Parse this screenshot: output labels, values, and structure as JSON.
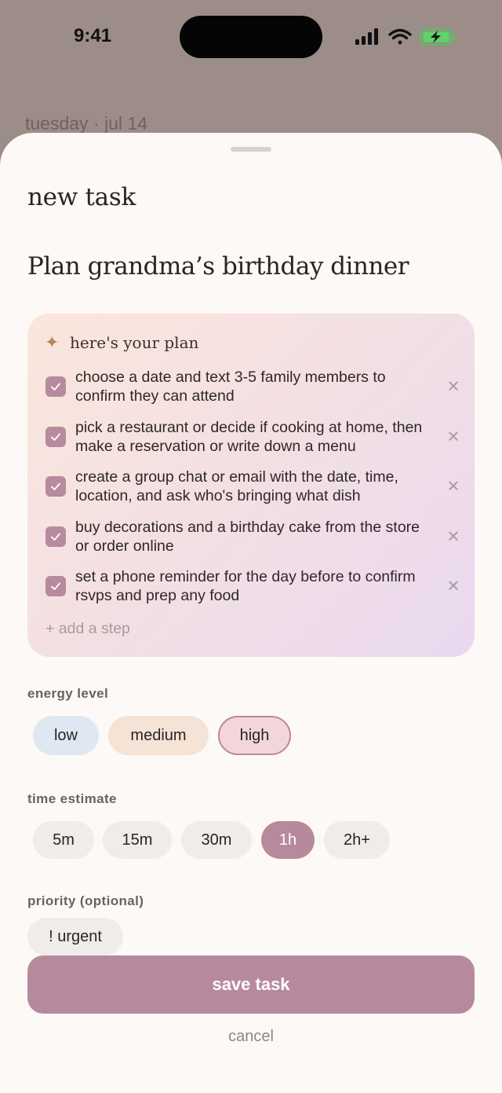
{
  "status_bar": {
    "time": "9:41"
  },
  "background": {
    "date_label": "tuesday · jul 14"
  },
  "sheet": {
    "title": "new task",
    "task_title": "Plan grandma’s birthday dinner"
  },
  "plan": {
    "label": "here's your plan",
    "steps": [
      {
        "text": "choose a date and text 3-5 family members to confirm they can attend",
        "checked": true
      },
      {
        "text": "pick a restaurant or decide if cooking at home, then make a reservation or write down a menu",
        "checked": true
      },
      {
        "text": "create a group chat or email with the date, time, location, and ask who's bringing what dish",
        "checked": true
      },
      {
        "text": "buy decorations and a birthday cake from the store or order online",
        "checked": true
      },
      {
        "text": "set a phone reminder for the day before to confirm rsvps and prep any food",
        "checked": true
      }
    ],
    "add_step_label": "+ add a step"
  },
  "energy": {
    "label": "energy level",
    "options": [
      "low",
      "medium",
      "high"
    ],
    "selected": "high"
  },
  "time_estimate": {
    "label": "time estimate",
    "options": [
      "5m",
      "15m",
      "30m",
      "1h",
      "2h+"
    ],
    "selected": "1h"
  },
  "priority": {
    "label": "priority (optional)",
    "urgent_label": "! urgent"
  },
  "actions": {
    "save_label": "save task",
    "cancel_label": "cancel"
  },
  "colors": {
    "accent": "#b68a9c",
    "energy_low": "#dfe8f2",
    "energy_medium": "#f5e3d6",
    "energy_high": "#f3d6da",
    "chip_neutral": "#efecea"
  }
}
